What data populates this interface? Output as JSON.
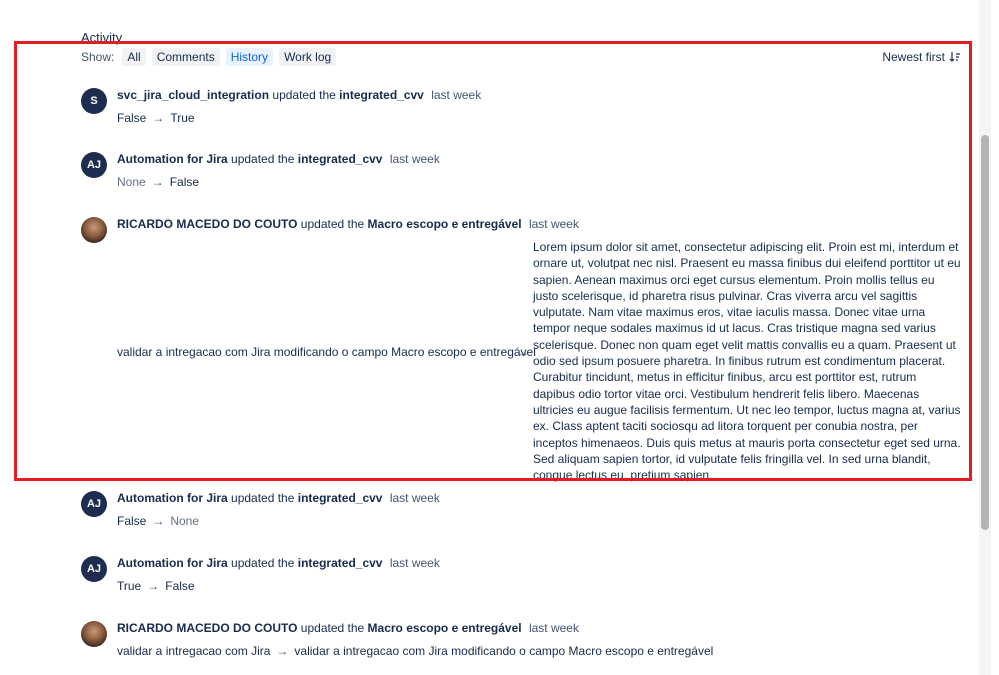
{
  "activity_title": "Activity",
  "filter": {
    "show_label": "Show:",
    "buttons": [
      "All",
      "Comments",
      "History",
      "Work log"
    ],
    "active": "History",
    "sort_label": "Newest first"
  },
  "entries": [
    {
      "avatar": "S",
      "author": "svc_jira_cloud_integration",
      "verb": "updated the",
      "field": "integrated_cvv",
      "time": "last week",
      "from": "False",
      "to": "True"
    },
    {
      "avatar": "AJ",
      "author": "Automation for Jira",
      "verb": "updated the",
      "field": "integrated_cvv",
      "time": "last week",
      "from": "None",
      "to": "False"
    },
    {
      "avatar": "",
      "author": "RICARDO MACEDO DO COUTO",
      "verb": "updated the",
      "field": "Macro escopo e entregável",
      "time": "last week",
      "from": "validar a intregacao com Jira modificando o campo Macro escopo e entregável",
      "to": "Lorem ipsum dolor sit amet, consectetur adipiscing elit. Proin est mi, interdum et ornare ut, volutpat nec nisl. Praesent eu massa finibus dui eleifend porttitor ut eu sapien. Aenean maximus orci eget cursus elementum. Proin mollis tellus eu justo scelerisque, id pharetra risus pulvinar. Cras viverra arcu vel sagittis vulputate. Nam vitae maximus eros, vitae iaculis massa. Donec vitae urna tempor neque sodales maximus id ut lacus. Cras tristique magna sed varius scelerisque. Donec non quam eget velit mattis convallis eu a quam. Praesent ut odio sed ipsum posuere pharetra. In finibus rutrum est condimentum placerat. Curabitur tincidunt, metus in efficitur finibus, arcu est porttitor est, rutrum dapibus odio tortor vitae orci. Vestibulum hendrerit felis libero. Maecenas ultricies eu augue facilisis fermentum. Ut nec leo tempor, luctus magna at, varius ex. Class aptent taciti sociosqu ad litora torquent per conubia nostra, per inceptos himenaeos. Duis quis metus at mauris porta consectetur eget sed urna. Sed aliquam sapien tortor, id vulputate felis fringilla vel. In sed urna blandit, congue lectus eu, pretium sapien."
    },
    {
      "avatar": "AJ",
      "author": "Automation for Jira",
      "verb": "updated the",
      "field": "integrated_cvv",
      "time": "last week",
      "from": "False",
      "to": "None"
    },
    {
      "avatar": "AJ",
      "author": "Automation for Jira",
      "verb": "updated the",
      "field": "integrated_cvv",
      "time": "last week",
      "from": "True",
      "to": "False"
    },
    {
      "avatar": "",
      "author": "RICARDO MACEDO DO COUTO",
      "verb": "updated the",
      "field": "Macro escopo e entregável",
      "time": "last week",
      "from": "validar a intregacao com Jira",
      "to": "validar a intregacao com Jira modificando o campo Macro escopo e entregável"
    }
  ],
  "arrow": "→",
  "colors": {
    "highlight": "#e31b23",
    "avatar_bg": "#1d2d50",
    "active_filter": "#0c66e4"
  }
}
